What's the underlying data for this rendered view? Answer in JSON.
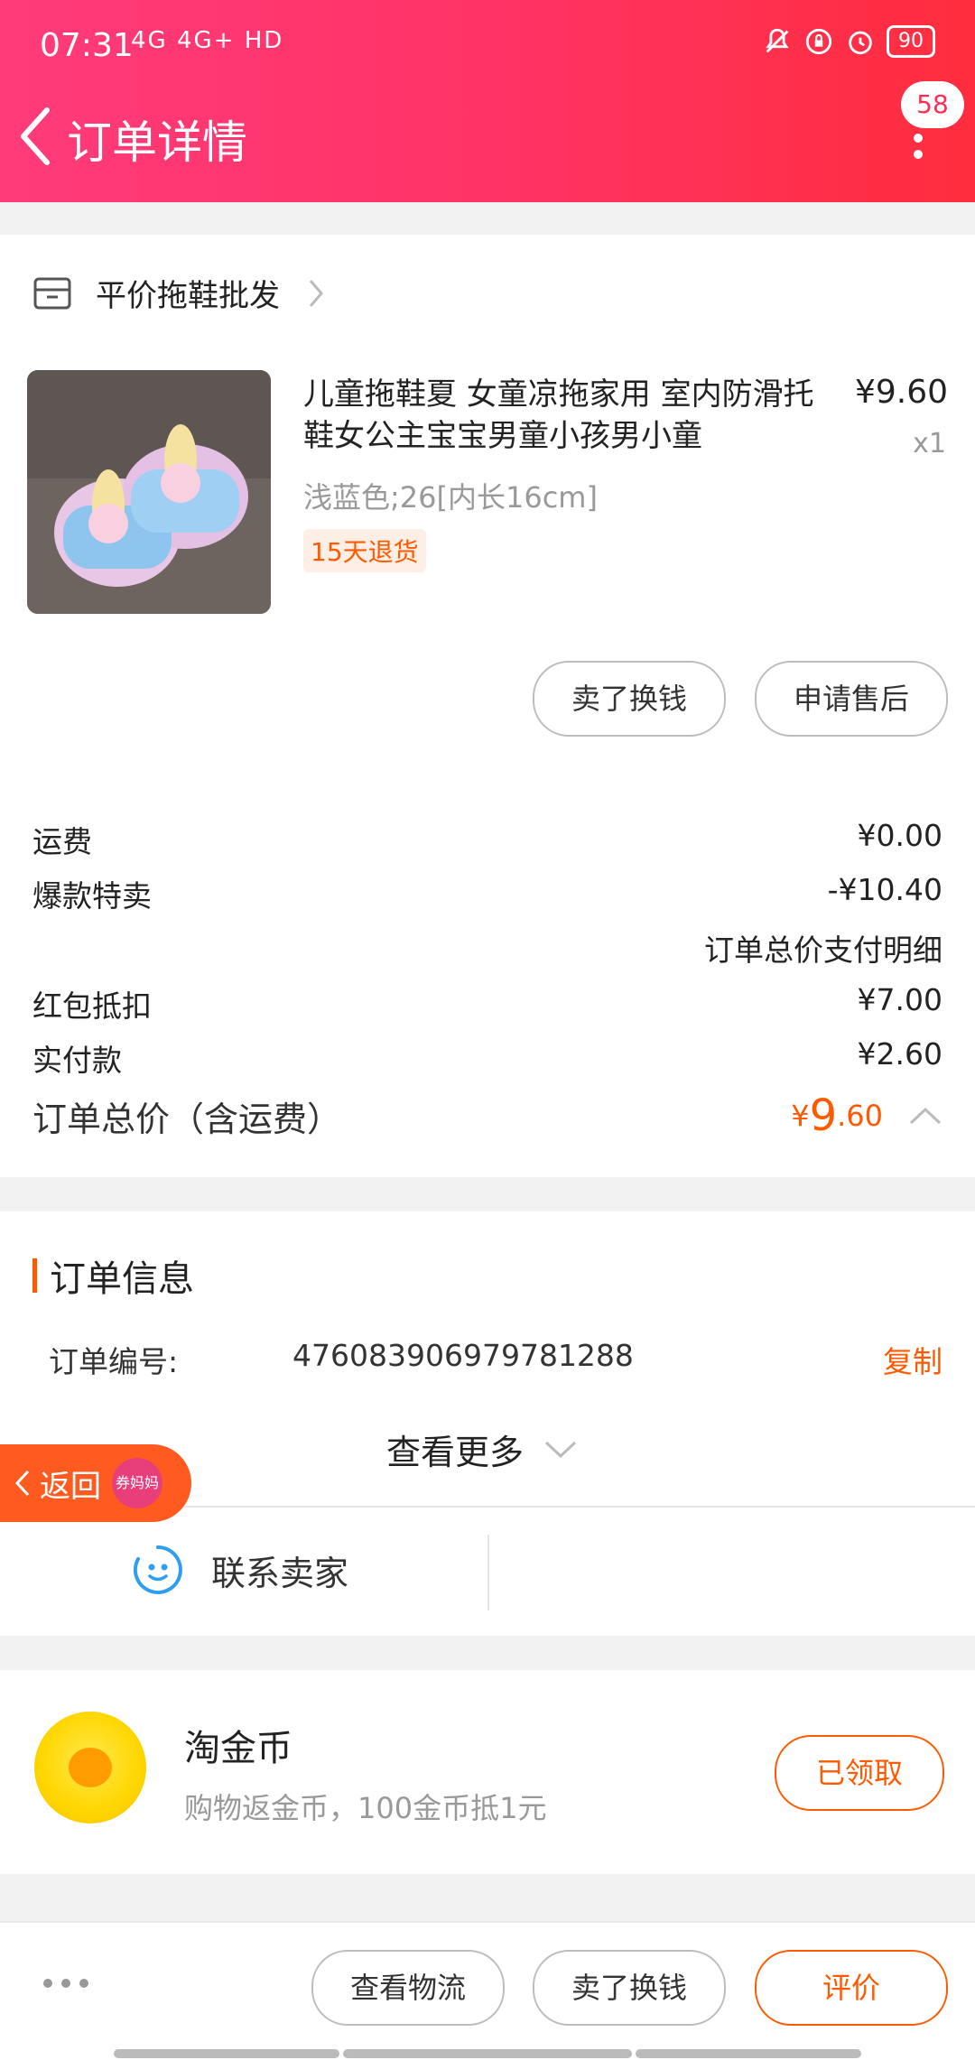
{
  "status_bar": {
    "time": "07:31",
    "network": "4G 4G+ HD",
    "battery": "90"
  },
  "header": {
    "title": "订单详情",
    "badge_count": "58"
  },
  "shop": {
    "name": "平价拖鞋批发"
  },
  "product": {
    "title": "儿童拖鞋夏 女童凉拖家用 室内防滑托鞋女公主宝宝男童小孩男小童",
    "price": "¥9.60",
    "qty": "x1",
    "spec": "浅蓝色;26[内长16cm]",
    "tag": "15天退货"
  },
  "product_actions": {
    "sell": "卖了换钱",
    "after_sale": "申请售后"
  },
  "fees": [
    {
      "label": "运费",
      "value": "¥0.00"
    },
    {
      "label": "爆款特卖",
      "value": "-¥10.40"
    },
    {
      "label": "",
      "value": "订单总价支付明细"
    },
    {
      "label": "红包抵扣",
      "value": "¥7.00"
    },
    {
      "label": "实付款",
      "value": "¥2.60"
    }
  ],
  "total": {
    "label": "订单总价（含运费）",
    "currency": "¥",
    "integer": "9",
    "decimal": ".60"
  },
  "order_info": {
    "title": "订单信息",
    "number_label": "订单编号:",
    "number": "476083906979781288",
    "copy": "复制",
    "see_more": "查看更多"
  },
  "contact": {
    "label": "联系卖家"
  },
  "float_back": {
    "label": "返回",
    "avatar_text": "券妈妈"
  },
  "coin": {
    "title": "淘金币",
    "subtitle": "购物返金币，100金币抵1元",
    "button": "已领取"
  },
  "bottom_bar": {
    "logistics": "查看物流",
    "sell": "卖了换钱",
    "review": "评价"
  },
  "colors": {
    "header": "#ff3366",
    "accent": "#ff5a00"
  }
}
